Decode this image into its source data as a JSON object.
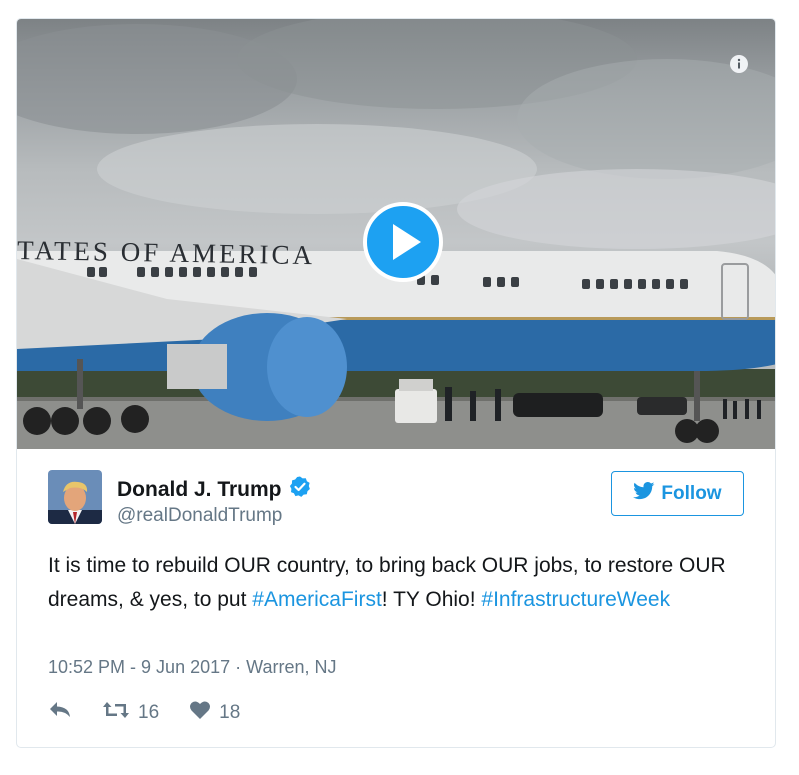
{
  "media": {
    "aircraft_lettering": "TATES OF AMERICA"
  },
  "user": {
    "name": "Donald J. Trump",
    "handle": "@realDonaldTrump",
    "verified": true
  },
  "follow_label": "Follow",
  "tweet": {
    "text_1": "It is time to rebuild OUR country, to bring back OUR jobs, to restore OUR dreams, & yes, to put ",
    "hashtag_1": "#AmericaFirst",
    "text_2": "! TY Ohio! ",
    "hashtag_2": "#InfrastructureWeek",
    "timestamp": "10:52 PM - 9 Jun 2017",
    "separator": " · ",
    "location": "Warren, NJ"
  },
  "actions": {
    "retweets": "16",
    "likes": "18"
  },
  "colors": {
    "accent": "#1da1f2",
    "link": "#1b95e0",
    "muted": "#657786"
  },
  "icons": [
    "info-icon",
    "play-icon",
    "verified-badge-icon",
    "twitter-bird-icon",
    "reply-icon",
    "retweet-icon",
    "heart-icon"
  ]
}
